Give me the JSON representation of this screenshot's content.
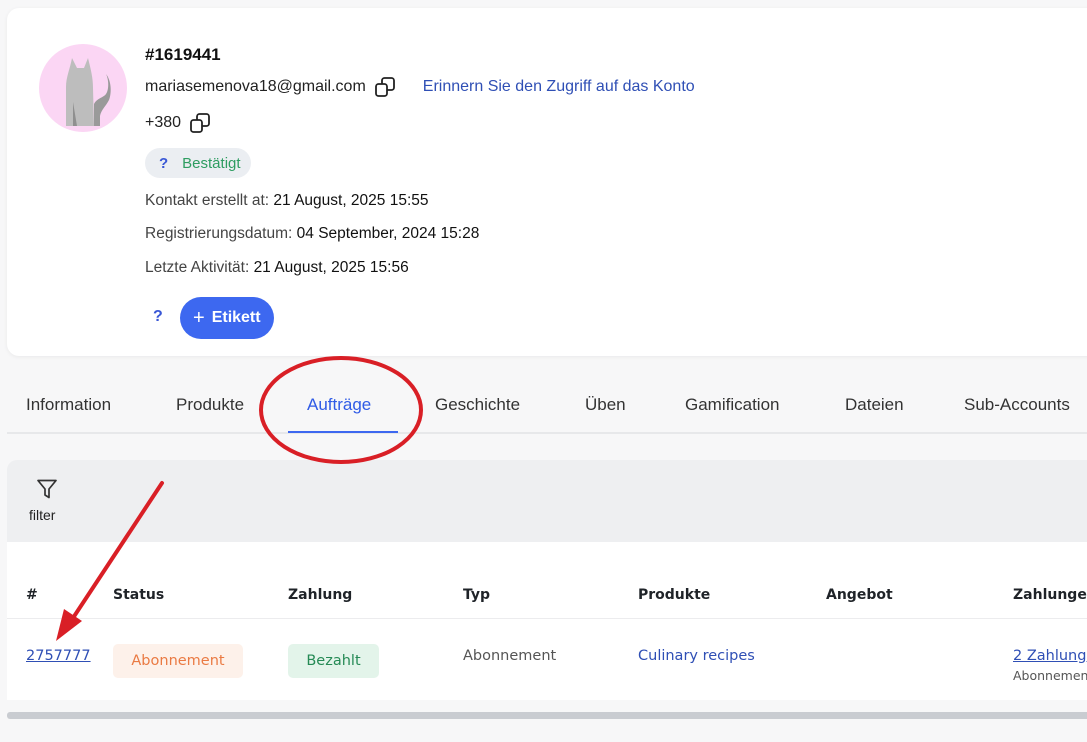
{
  "profile": {
    "id": "#1619441",
    "email": "mariasemenova18@gmail.com",
    "remind_link": "Erinnern Sie den Zugriff auf das Konto",
    "phone": "+380",
    "status": {
      "icon": "?",
      "label": "Bestätigt"
    },
    "meta": [
      {
        "label": "Kontakt erstellt at:",
        "value": "21 August, 2025 15:55"
      },
      {
        "label": "Registrierungsdatum:",
        "value": "04 September, 2024 15:28"
      },
      {
        "label": "Letzte Aktivität:",
        "value": "21 August, 2025 15:56"
      }
    ],
    "tag_help": "?",
    "tag_button": {
      "icon": "+",
      "label": "Etikett"
    }
  },
  "tabs": [
    {
      "label": "Information"
    },
    {
      "label": "Produkte"
    },
    {
      "label": "Aufträge",
      "active": true
    },
    {
      "label": "Geschichte"
    },
    {
      "label": "Üben"
    },
    {
      "label": "Gamification"
    },
    {
      "label": "Dateien"
    },
    {
      "label": "Sub-Accounts"
    }
  ],
  "filter": {
    "label": "filter",
    "icon": "funnel-icon"
  },
  "table": {
    "columns": [
      "#",
      "Status",
      "Zahlung",
      "Typ",
      "Produkte",
      "Angebot",
      "Zahlungen"
    ],
    "rows": [
      {
        "order_id": "2757777",
        "status": "Abonnement",
        "payment": "Bezahlt",
        "type": "Abonnement",
        "product": "Culinary recipes",
        "offer": "",
        "payments": "2 Zahlung",
        "payments_sub": "Abonnement"
      }
    ]
  },
  "colors": {
    "accent": "#3d68f0",
    "link": "#2f4fb5",
    "confirmed": "#2e9d61",
    "subscription_badge": "#ea7a43",
    "paid_badge": "#258a55",
    "annotation": "#d91f26"
  }
}
